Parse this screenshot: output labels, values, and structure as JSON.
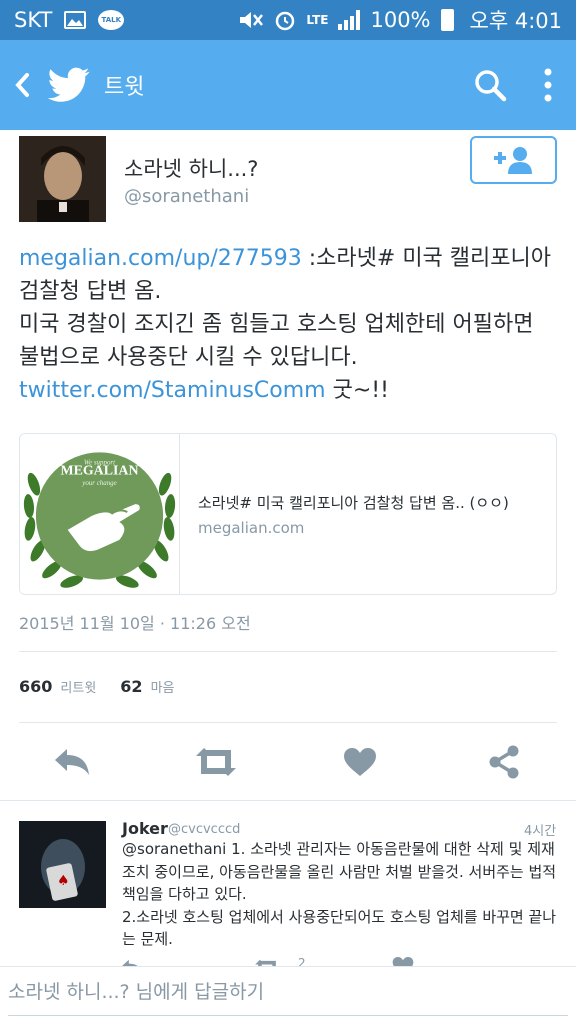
{
  "status_bar": {
    "carrier": "SKT",
    "talk_icon_label": "TALK",
    "network": "LTE",
    "battery": "100%",
    "time": "오후 4:01"
  },
  "app_bar": {
    "title": "트윗",
    "icons": [
      "back-icon",
      "twitter-bird-icon",
      "search-icon",
      "more-vert-icon"
    ]
  },
  "tweet": {
    "display_name": "소라넷 하니...?",
    "screen_name": "@soranethani",
    "text": {
      "link1": "megalian.com/up/277593",
      "part1": " :소라넷# 미국 캘리포니아 검찰청 답변 옴.",
      "line2": "미국 경찰이 조지긴 좀 힘들고 호스팅 업체한테 어필하면 불법으로 사용중단 시킬 수 있답니다.",
      "link2": "twitter.com/StaminusComm",
      "part3": " 굿~!!"
    },
    "card": {
      "title": "소라넷# 미국 캘리포니아 검찰청 답변 옴.. (ㅇㅇ)",
      "domain": "megalian.com",
      "logo": {
        "top": "We support",
        "name": "MEGALIAN",
        "bottom": "your change"
      }
    },
    "timestamp": "2015년 11월 10일 · 11:26 오전",
    "retweet_count": "660",
    "retweet_label": "리트윗",
    "like_count": "62",
    "like_label": "마음",
    "actions": [
      "reply-icon",
      "retweet-icon",
      "heart-icon",
      "share-icon"
    ]
  },
  "reply": {
    "name": "Joker",
    "handle": "@cvcvcccd",
    "time": "4시간",
    "text": "@soranethani 1. 소라넷 관리자는 아동음란물에 대한 삭제 및 제재 조치 중이므로, 아동음란물을 올린 사람만 처벌 받을것. 서버주는 법적책임을 다하고 있다.",
    "text2": "2.소라넷 호스팅 업체에서 사용중단되어도 호스팅 업체를 바꾸면 끝나는 문제.",
    "retweet_count": "2"
  },
  "compose": {
    "placeholder": "소라넷 하니...? 님에게 답글하기"
  },
  "colors": {
    "status_bar": "#3383c4",
    "app_bar": "#55acee",
    "link": "#3b94d9",
    "secondary_text": "#8899a6",
    "action_icon": "#8899a6",
    "logo_green": "#6f9a5a",
    "laurel": "#3d7a2a"
  }
}
